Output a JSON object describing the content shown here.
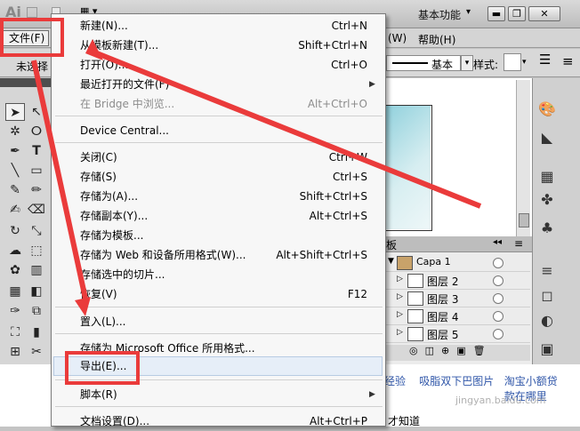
{
  "app": {
    "workspace_label": "基本功能",
    "window_buttons": [
      "▬",
      "❐",
      "✕"
    ]
  },
  "menubar": {
    "file": "文件(F)",
    "window": "(W)",
    "help": "帮助(H)"
  },
  "controlbar": {
    "selection_text": "未选择",
    "stroke_label": "基本",
    "style_label": "样式:"
  },
  "file_menu": {
    "items": [
      {
        "label": "新建(N)...",
        "shortcut": "Ctrl+N"
      },
      {
        "label": "从模板新建(T)...",
        "shortcut": "Shift+Ctrl+N"
      },
      {
        "label": "打开(O)...",
        "shortcut": "Ctrl+O"
      },
      {
        "label": "最近打开的文件(F)",
        "shortcut": ""
      },
      {
        "label": "在 Bridge 中浏览...",
        "shortcut": "Alt+Ctrl+O"
      },
      {
        "label": "Device Central...",
        "shortcut": ""
      },
      {
        "label": "关闭(C)",
        "shortcut": "Ctrl+W"
      },
      {
        "label": "存储(S)",
        "shortcut": "Ctrl+S"
      },
      {
        "label": "存储为(A)...",
        "shortcut": "Shift+Ctrl+S"
      },
      {
        "label": "存储副本(Y)...",
        "shortcut": "Alt+Ctrl+S"
      },
      {
        "label": "存储为模板...",
        "shortcut": ""
      },
      {
        "label": "存储为 Web 和设备所用格式(W)...",
        "shortcut": "Alt+Shift+Ctrl+S"
      },
      {
        "label": "存储选中的切片...",
        "shortcut": ""
      },
      {
        "label": "恢复(V)",
        "shortcut": "F12"
      },
      {
        "label": "置入(L)...",
        "shortcut": ""
      },
      {
        "label": "存储为 Microsoft Office 所用格式...",
        "shortcut": ""
      },
      {
        "label": "导出(E)...",
        "shortcut": ""
      },
      {
        "label": "脚本(R)",
        "shortcut": ""
      },
      {
        "label": "文档设置(D)...",
        "shortcut": "Alt+Ctrl+P"
      }
    ]
  },
  "layers_panel": {
    "tab_label": "板",
    "layers": [
      "Capa 1",
      "图层 2",
      "图层 3",
      "图层 4",
      "图层 5"
    ]
  },
  "footer": {
    "links": [
      "经验",
      "吸脂双下巴图片",
      "淘宝小额贷款在哪里"
    ],
    "bottom_text": "才知道",
    "watermark": "jingyan.baidu.com"
  },
  "colors": {
    "annotation_red": "#ea3b3b",
    "menu_bg": "#f7f7f7",
    "highlight": "#e6eef8"
  }
}
